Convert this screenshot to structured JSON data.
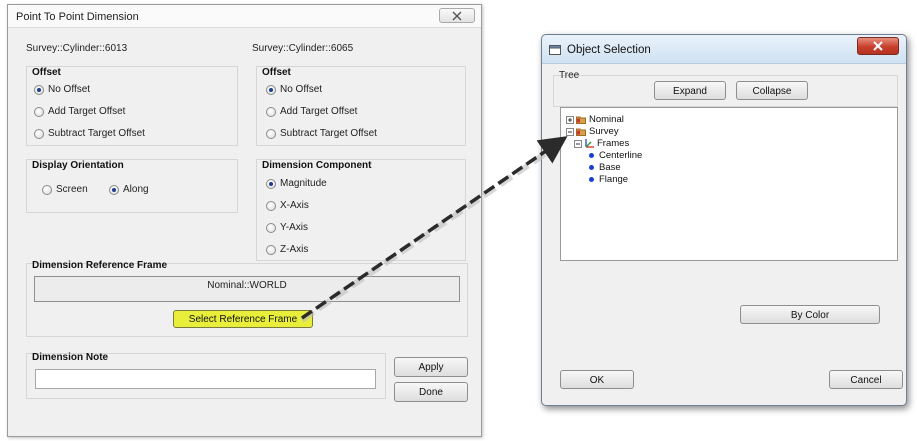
{
  "dialog1": {
    "title": "Point To Point Dimension",
    "left_object": "Survey::Cylinder::6013",
    "right_object": "Survey::Cylinder::6065",
    "offset_left": {
      "label": "Offset",
      "options": [
        "No Offset",
        "Add Target Offset",
        "Subtract Target Offset"
      ],
      "selected": "No Offset"
    },
    "offset_right": {
      "label": "Offset",
      "options": [
        "No Offset",
        "Add Target Offset",
        "Subtract Target Offset"
      ],
      "selected": "No Offset"
    },
    "display_orientation": {
      "label": "Display Orientation",
      "options": [
        "Screen",
        "Along"
      ],
      "selected": "Along"
    },
    "dimension_component": {
      "label": "Dimension Component",
      "options": [
        "Magnitude",
        "X-Axis",
        "Y-Axis",
        "Z-Axis"
      ],
      "selected": "Magnitude"
    },
    "reference_frame": {
      "label": "Dimension Reference Frame",
      "value": "Nominal::WORLD",
      "button": "Select Reference Frame"
    },
    "note": {
      "label": "Dimension Note",
      "value": ""
    },
    "apply_button": "Apply",
    "done_button": "Done"
  },
  "dialog2": {
    "title": "Object Selection",
    "tree_label": "Tree",
    "expand_button": "Expand",
    "collapse_button": "Collapse",
    "tree": {
      "nominal": "Nominal",
      "survey": "Survey",
      "frames": "Frames",
      "children": [
        "Centerline",
        "Base",
        "Flange"
      ]
    },
    "by_color_button": "By Color",
    "ok_button": "OK",
    "cancel_button": "Cancel"
  },
  "colors": {
    "highlight_button": "#e8ee3a",
    "radio_dot": "#1f3f8f",
    "tree_dot": "#1a3fd0",
    "close_red": "#c8402c"
  },
  "icons": [
    "close-icon",
    "window-icon",
    "folder-icon",
    "frames-icon",
    "expand-plus-icon",
    "collapse-minus-icon"
  ]
}
